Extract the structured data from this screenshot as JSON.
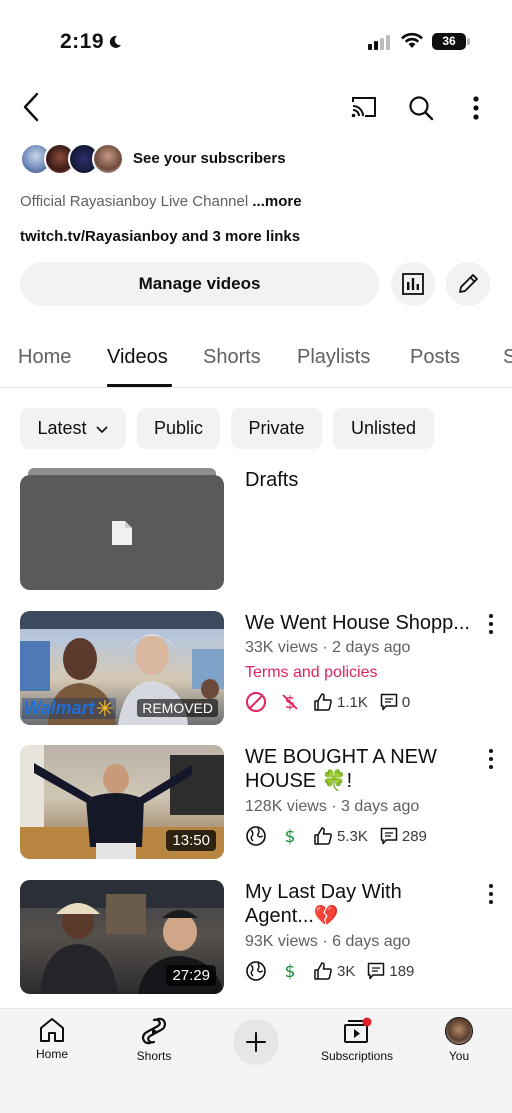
{
  "status_bar": {
    "time": "2:19",
    "battery": "36"
  },
  "channel": {
    "see_subscribers": "See your subscribers",
    "description": "Official Rayasianboy Live Channel",
    "more_label": "...more",
    "links": "twitch.tv/Rayasianboy and 3 more links"
  },
  "actions": {
    "manage_videos": "Manage videos"
  },
  "tabs": [
    {
      "label": "Home"
    },
    {
      "label": "Videos"
    },
    {
      "label": "Shorts"
    },
    {
      "label": "Playlists"
    },
    {
      "label": "Posts"
    },
    {
      "label": "S"
    }
  ],
  "filters": {
    "latest": "Latest",
    "public": "Public",
    "private": "Private",
    "unlisted": "Unlisted"
  },
  "drafts": {
    "label": "Drafts"
  },
  "videos": [
    {
      "title": "We Went House Shopp...",
      "meta": "33K views · 2 days ago",
      "notice": "Terms and policies",
      "badge": "REMOVED",
      "brand": "Walmart",
      "likes": "1.1K",
      "comments": "0"
    },
    {
      "title_line1": "WE BOUGHT A NEW",
      "title_line2": "HOUSE 🍀!",
      "meta": "128K views · 3 days ago",
      "duration": "13:50",
      "likes": "5.3K",
      "comments": "289"
    },
    {
      "title_line1": "My Last Day With",
      "title_line2": "Agent...💔",
      "meta": "93K views · 6 days ago",
      "duration": "27:29",
      "likes": "3K",
      "comments": "189"
    }
  ],
  "bottom_nav": {
    "home": "Home",
    "shorts": "Shorts",
    "subscriptions": "Subscriptions",
    "you": "You"
  },
  "colors": {
    "accent_red": "#e0245e",
    "monetized_green": "#1a8a3a",
    "chip_bg": "#f2f2f2"
  }
}
